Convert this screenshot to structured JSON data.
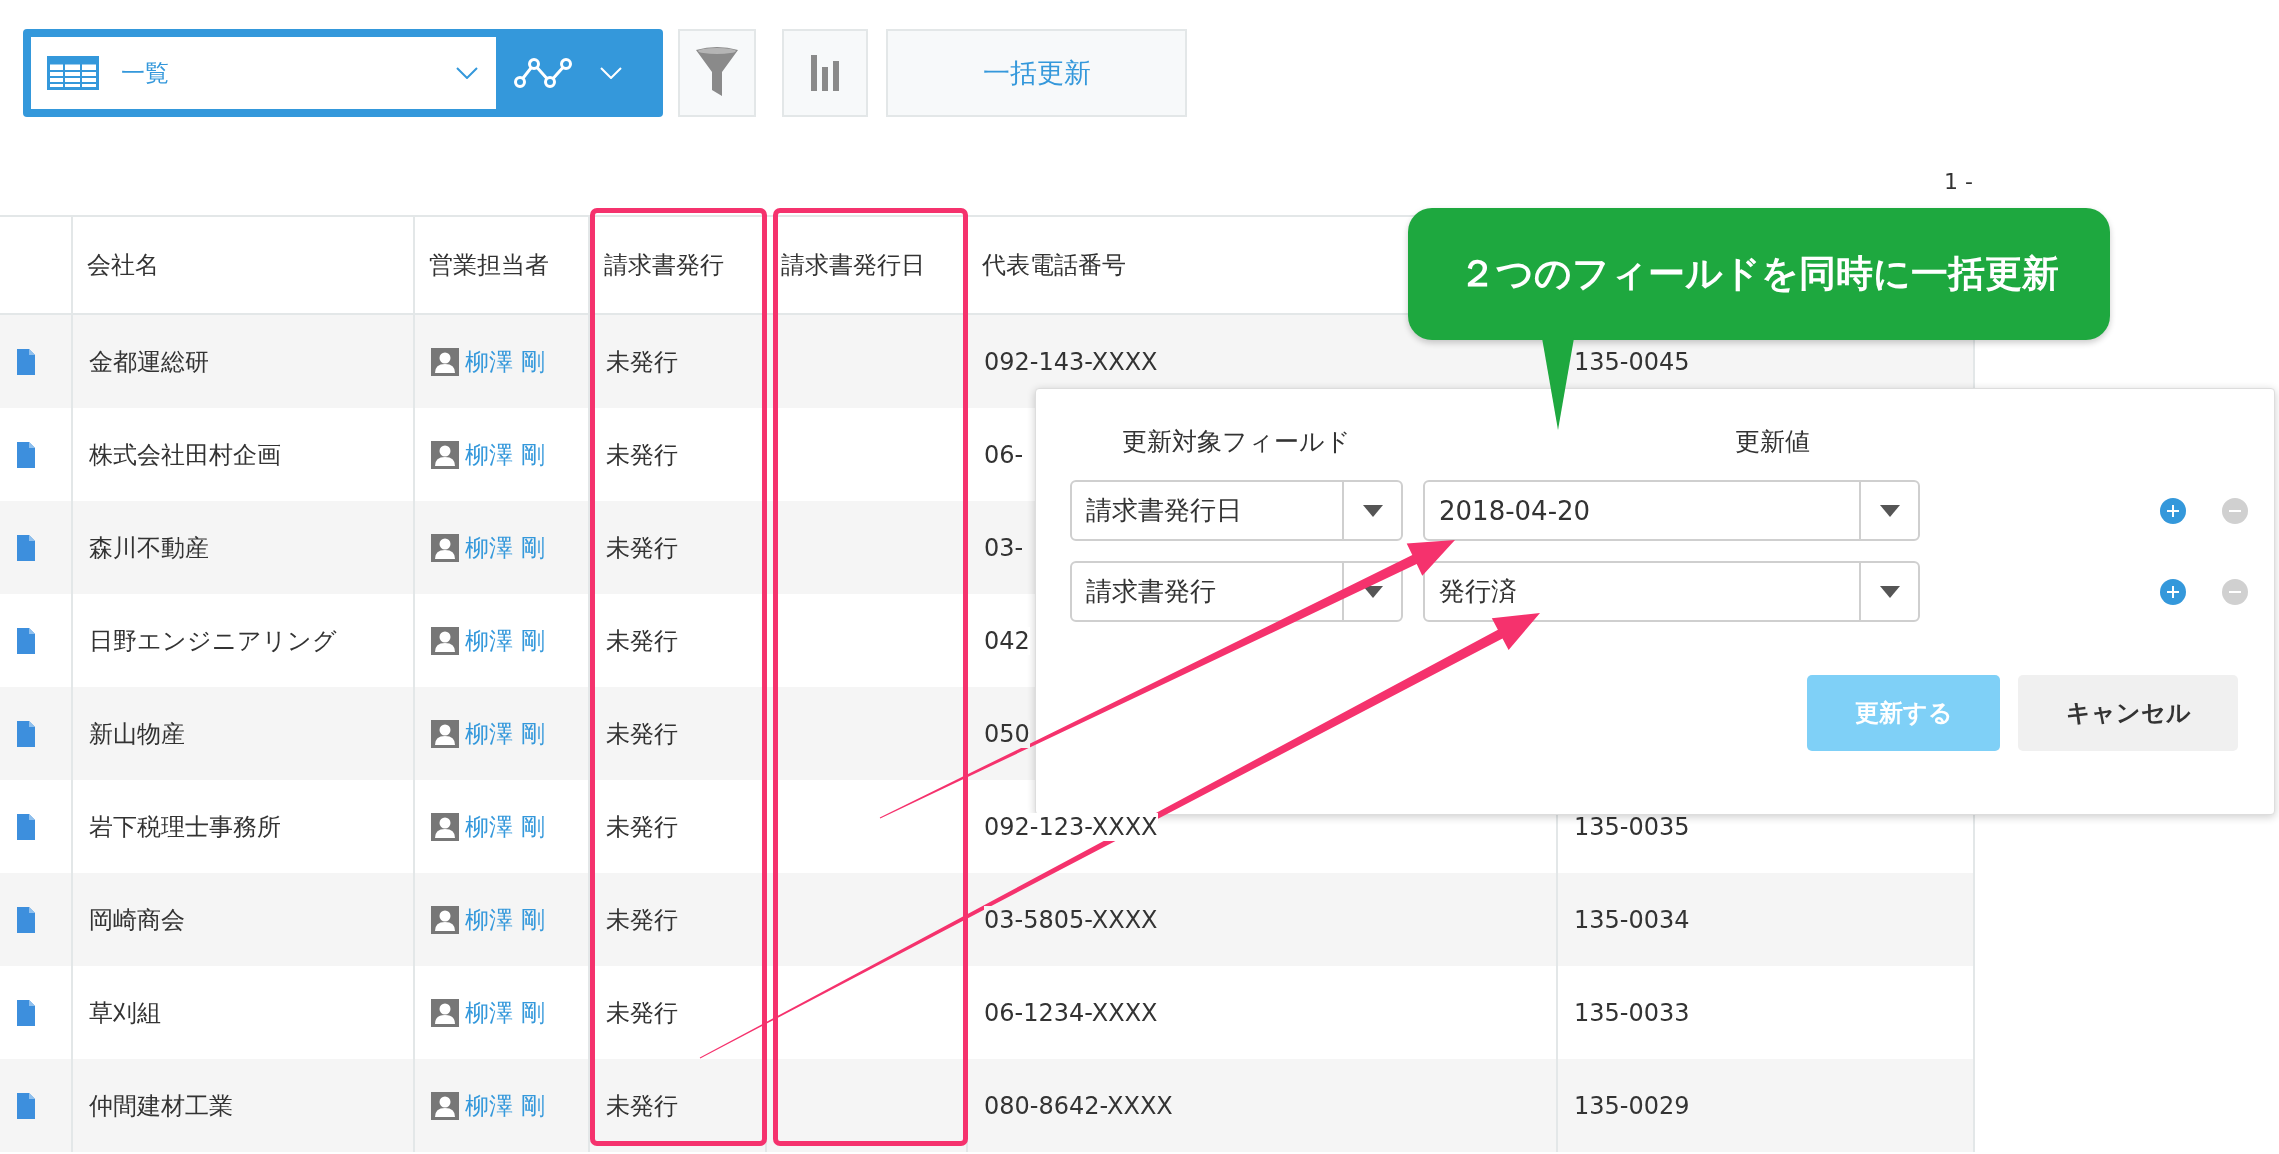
{
  "toolbar": {
    "view_selector": {
      "label": "一覧"
    },
    "bulk_update_button": {
      "label": "一括更新"
    }
  },
  "pagination": {
    "text": "1 -"
  },
  "table": {
    "columns": [
      {
        "label": "会社名",
        "highlighted": false
      },
      {
        "label": "営業担当者",
        "highlighted": false
      },
      {
        "label": "請求書発行",
        "highlighted": true
      },
      {
        "label": "請求書発行日",
        "highlighted": true
      },
      {
        "label": "代表電話番号",
        "highlighted": false
      }
    ],
    "rows": [
      {
        "company": "金都運総研",
        "rep": "柳澤 剛",
        "invoice_status": "未発行",
        "phone": "092-143-XXXX",
        "postal": "135-0045"
      },
      {
        "company": "株式会社田村企画",
        "rep": "柳澤 剛",
        "invoice_status": "未発行",
        "phone": "06-"
      },
      {
        "company": "森川不動産",
        "rep": "柳澤 剛",
        "invoice_status": "未発行",
        "phone": "03-"
      },
      {
        "company": "日野エンジニアリング",
        "rep": "柳澤 剛",
        "invoice_status": "未発行",
        "phone": "042"
      },
      {
        "company": "新山物産",
        "rep": "柳澤 剛",
        "invoice_status": "未発行",
        "phone": "050"
      },
      {
        "company": "岩下税理士事務所",
        "rep": "柳澤 剛",
        "invoice_status": "未発行",
        "phone": "092-123-XXXX",
        "postal": "135-0035"
      },
      {
        "company": "岡崎商会",
        "rep": "柳澤 剛",
        "invoice_status": "未発行",
        "phone": "03-5805-XXXX",
        "postal": "135-0034"
      },
      {
        "company": "草刈組",
        "rep": "柳澤 剛",
        "invoice_status": "未発行",
        "phone": "06-1234-XXXX",
        "postal": "135-0033"
      },
      {
        "company": "仲間建材工業",
        "rep": "柳澤 剛",
        "invoice_status": "未発行",
        "phone": "080-8642-XXXX",
        "postal": "135-0029"
      }
    ]
  },
  "callout": {
    "text": "２つのフィールドを同時に一括更新"
  },
  "bulk_update_dialog": {
    "field_header": "更新対象フィールド",
    "value_header": "更新値",
    "rows": [
      {
        "field": "請求書発行日",
        "value": "2018-04-20"
      },
      {
        "field": "請求書発行",
        "value": "発行済"
      }
    ],
    "update_button": {
      "label": "更新する",
      "disabled": true
    },
    "cancel_button": {
      "label": "キャンセル"
    }
  }
}
